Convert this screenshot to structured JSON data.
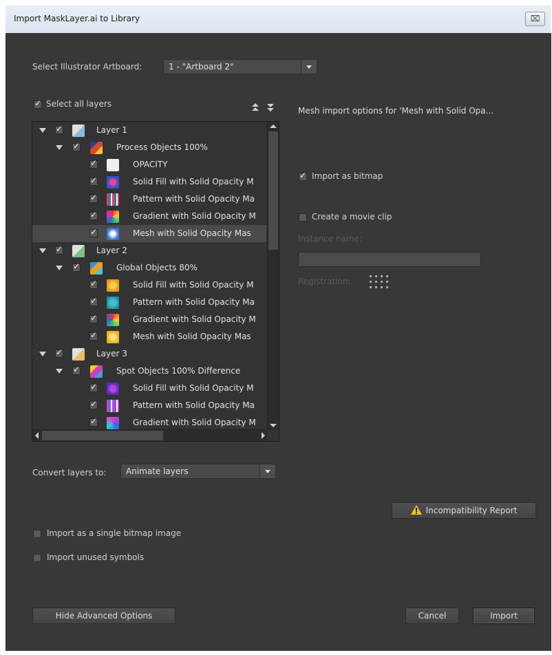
{
  "window": {
    "title": "Import MaskLayer.ai to Library",
    "close_glyph": "⌧"
  },
  "artboard": {
    "label": "Select Illustrator Artboard:",
    "value": "1 - \"Artboard 2\""
  },
  "select_all": {
    "label": "Select all layers",
    "checked": true
  },
  "mesh_options": {
    "heading": "Mesh import options for 'Mesh with Solid Opa...",
    "import_as_bitmap": {
      "label": "Import as bitmap",
      "checked": true
    },
    "create_movie_clip": {
      "label": "Create a movie clip",
      "checked": false
    },
    "instance_name_label": "Instance name:",
    "instance_name_value": "",
    "registration_label": "Registration:"
  },
  "layers": [
    {
      "name": "Layer 1",
      "kind": "layer",
      "checked": true,
      "expanded": true
    },
    {
      "name": "Process Objects 100%",
      "kind": "group",
      "checked": true,
      "expanded": true
    },
    {
      "name": "OPACITY",
      "kind": "item",
      "checked": true
    },
    {
      "name": "Solid Fill with Solid Opacity M",
      "kind": "item",
      "checked": true
    },
    {
      "name": "Pattern with Solid Opacity Ma",
      "kind": "item",
      "checked": true
    },
    {
      "name": "Gradient with Solid Opacity M",
      "kind": "item",
      "checked": true
    },
    {
      "name": "Mesh with Solid Opacity Mas",
      "kind": "item",
      "checked": true,
      "selected": true
    },
    {
      "name": "Layer 2",
      "kind": "layer",
      "checked": true,
      "expanded": true
    },
    {
      "name": "Global Objects 80%",
      "kind": "group",
      "checked": true,
      "expanded": true
    },
    {
      "name": "Solid Fill with Solid Opacity M",
      "kind": "item",
      "checked": true
    },
    {
      "name": "Pattern with Solid Opacity Ma",
      "kind": "item",
      "checked": true
    },
    {
      "name": "Gradient with Solid Opacity M",
      "kind": "item",
      "checked": true
    },
    {
      "name": "Mesh with Solid Opacity Mas",
      "kind": "item",
      "checked": true
    },
    {
      "name": "Layer 3",
      "kind": "layer",
      "checked": true,
      "expanded": true
    },
    {
      "name": "Spot Objects 100% Difference",
      "kind": "group",
      "checked": true,
      "expanded": true
    },
    {
      "name": "Solid Fill with Solid Opacity M",
      "kind": "item",
      "checked": true
    },
    {
      "name": "Pattern with Solid Opacity Ma",
      "kind": "item",
      "checked": true
    },
    {
      "name": "Gradient with Solid Opacity M",
      "kind": "item",
      "checked": true
    }
  ],
  "convert": {
    "label": "Convert layers to:",
    "value": "Animate layers"
  },
  "incompatibility_button": "Incompatibility Report",
  "import_single_bitmap": {
    "label": "Import as a single bitmap image",
    "checked": false
  },
  "import_unused_symbols": {
    "label": "Import unused symbols",
    "checked": false
  },
  "buttons": {
    "hide_advanced": "Hide Advanced Options",
    "cancel": "Cancel",
    "import": "Import"
  },
  "colors": {
    "panel_bg": "#383838",
    "warning": "#f0c419"
  }
}
